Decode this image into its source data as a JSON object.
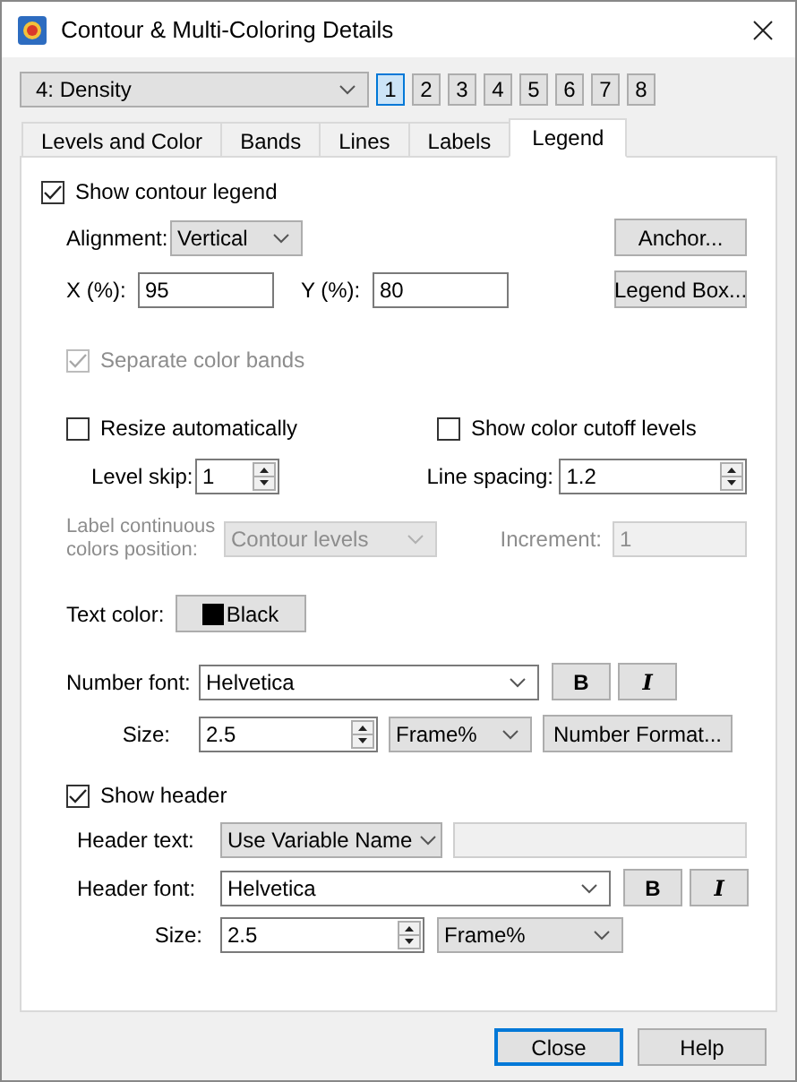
{
  "window": {
    "title": "Contour & Multi-Coloring Details"
  },
  "zone_select": {
    "value": "4: Density"
  },
  "group_buttons": [
    {
      "label": "1",
      "selected": true
    },
    {
      "label": "2",
      "selected": false
    },
    {
      "label": "3",
      "selected": false
    },
    {
      "label": "4",
      "selected": false
    },
    {
      "label": "5",
      "selected": false
    },
    {
      "label": "6",
      "selected": false
    },
    {
      "label": "7",
      "selected": false
    },
    {
      "label": "8",
      "selected": false
    }
  ],
  "tabs": [
    {
      "label": "Levels and Color",
      "selected": false
    },
    {
      "label": "Bands",
      "selected": false
    },
    {
      "label": "Lines",
      "selected": false
    },
    {
      "label": "Labels",
      "selected": false
    },
    {
      "label": "Legend",
      "selected": true
    }
  ],
  "legend": {
    "show_contour_legend": {
      "label": "Show contour legend",
      "checked": true
    },
    "alignment": {
      "label": "Alignment:",
      "value": "Vertical"
    },
    "anchor_button": "Anchor...",
    "x": {
      "label": "X (%):",
      "value": "95"
    },
    "y": {
      "label": "Y (%):",
      "value": "80"
    },
    "legend_box_button": "Legend Box...",
    "separate_color_bands": {
      "label": "Separate color bands",
      "checked": true,
      "disabled": true
    },
    "resize_automatically": {
      "label": "Resize automatically",
      "checked": false
    },
    "show_color_cutoff_levels": {
      "label": "Show color cutoff levels",
      "checked": false
    },
    "level_skip": {
      "label": "Level skip:",
      "value": "1"
    },
    "line_spacing": {
      "label": "Line spacing:",
      "value": "1.2"
    },
    "label_position": {
      "label": "Label continuous colors position:",
      "value": "Contour levels",
      "disabled": true
    },
    "increment": {
      "label": "Increment:",
      "value": "1",
      "disabled": true
    },
    "text_color": {
      "label": "Text color:",
      "value": "Black",
      "color": "#000000"
    },
    "number_font": {
      "label": "Number font:",
      "value": "Helvetica",
      "bold": "B",
      "italic": "I"
    },
    "number_size": {
      "label": "Size:",
      "value": "2.5",
      "units": "Frame%"
    },
    "number_format_button": "Number Format...",
    "show_header": {
      "label": "Show header",
      "checked": true
    },
    "header_text": {
      "label": "Header text:",
      "mode": "Use Variable Name"
    },
    "header_font": {
      "label": "Header font:",
      "value": "Helvetica",
      "bold": "B",
      "italic": "I"
    },
    "header_size": {
      "label": "Size:",
      "value": "2.5",
      "units": "Frame%"
    }
  },
  "buttons": [
    {
      "label": "Close",
      "default": true
    },
    {
      "label": "Help",
      "default": false
    }
  ]
}
